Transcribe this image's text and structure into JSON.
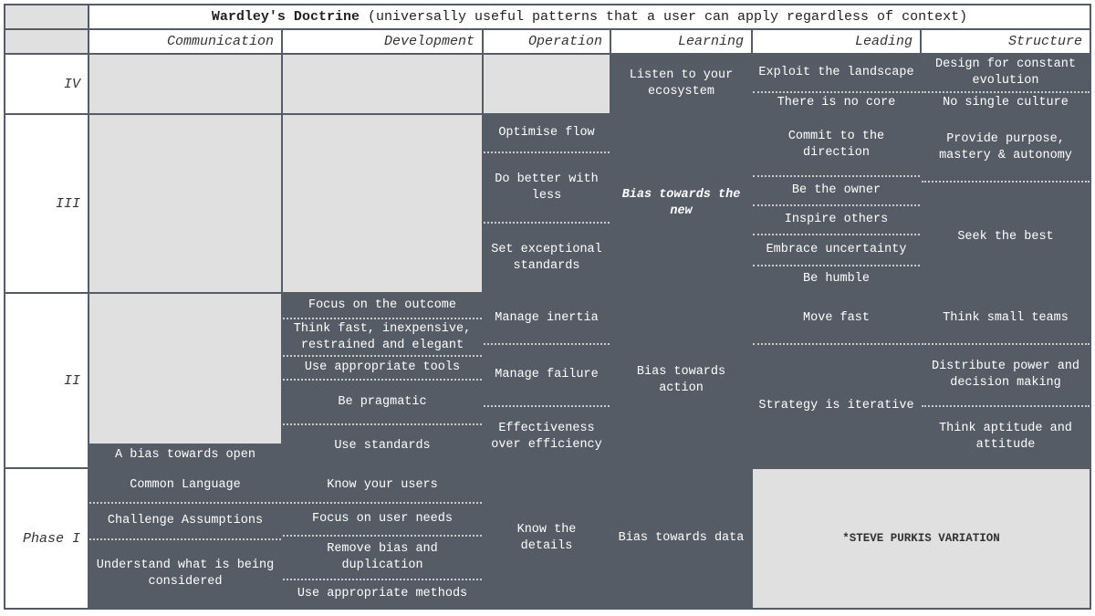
{
  "title_bold": "Wardley's Doctrine",
  "title_rest": "(universally useful patterns that a user can apply regardless of context)",
  "columns": {
    "communication": "Communication",
    "development": "Development",
    "operation": "Operation",
    "learning": "Learning",
    "leading": "Leading",
    "structure": "Structure"
  },
  "phases": {
    "iv": "IV",
    "iii": "III",
    "ii": "II",
    "i": "Phase I"
  },
  "cells": {
    "iv": {
      "learning": "Listen to your ecosystem",
      "leading1": "Exploit the landscape",
      "leading2": "There is no core",
      "structure1": "Design for constant evolution",
      "structure2": "No single culture"
    },
    "iii": {
      "operation1": "Optimise flow",
      "operation2": "Do better with less",
      "operation3": "Set exceptional standards",
      "learning": "Bias towards the new",
      "leading1": "Commit to the direction",
      "leading2": "Be the owner",
      "leading3": "Inspire others",
      "leading4": "Embrace uncertainty",
      "leading5": "Be humble",
      "structure1": "Provide purpose, mastery & autonomy",
      "structure2": "Seek the best"
    },
    "ii": {
      "communication": "A bias towards open",
      "development1": "Focus on the outcome",
      "development2": "Think fast, inexpensive, restrained and elegant",
      "development3": "Use appropriate tools",
      "development4": "Be pragmatic",
      "development5": "Use standards",
      "operation1": "Manage inertia",
      "operation2": "Manage failure",
      "operation3": "Effectiveness over efficiency",
      "learning": "Bias towards action",
      "leading1": "Move fast",
      "leading2": "Strategy is iterative",
      "structure1": "Think small teams",
      "structure2": "Distribute power and decision making",
      "structure3": "Think aptitude and attitude"
    },
    "i": {
      "communication1": "Common Language",
      "communication2": "Challenge Assumptions",
      "communication3": "Understand what is being considered",
      "development1": "Know your users",
      "development2": "Focus on user needs",
      "development3": "Remove bias and duplication",
      "development4": "Use appropriate methods",
      "operation": "Know the details",
      "learning": "Bias towards data"
    }
  },
  "note": "*STEVE PURKIS VARIATION"
}
